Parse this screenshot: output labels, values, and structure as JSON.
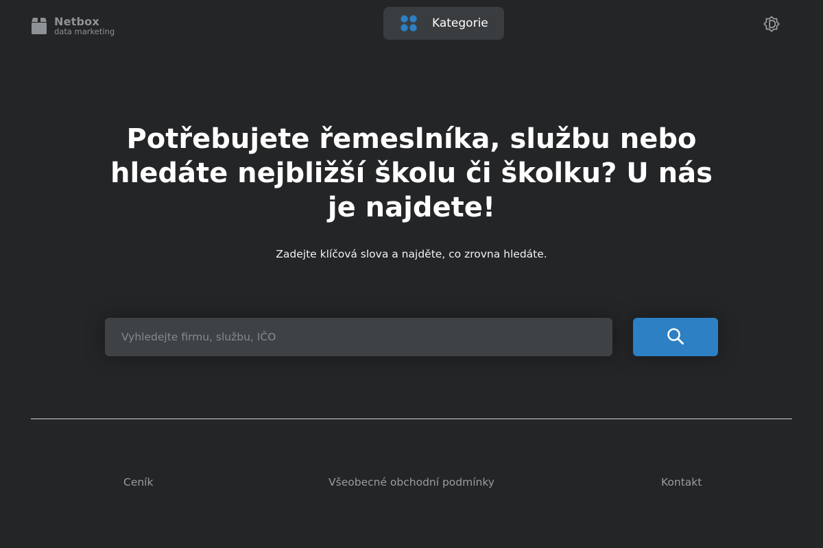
{
  "header": {
    "logo": {
      "name": "Netbox",
      "subtitle": "data marketing",
      "icon": "box-icon"
    },
    "categories": {
      "label": "Kategorie",
      "icon": "grid-dots-icon",
      "icon_color": "#2c80c3"
    },
    "theme_toggle": {
      "icon": "theme-gear-icon"
    }
  },
  "hero": {
    "headline": "Potřebujete řemeslníka, službu nebo hledáte nejbližší školu či školku? U nás je najdete!",
    "subline": "Zadejte klíčová slova a najděte, co zrovna hledáte."
  },
  "search": {
    "placeholder": "Vyhledejte firmu, službu, IČO",
    "value": "",
    "button_icon": "search-icon",
    "button_color": "#2c80c3"
  },
  "footer": {
    "links": {
      "pricing": "Ceník",
      "terms": "Všeobecné obchodní podmínky",
      "contact": "Kontakt"
    }
  },
  "colors": {
    "background": "#242527",
    "accent": "#2c80c3"
  }
}
